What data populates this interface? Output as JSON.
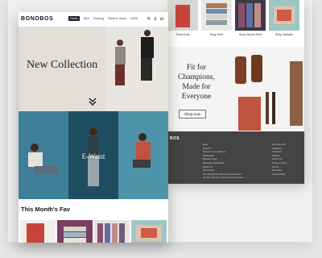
{
  "front": {
    "brand": "BONOBOS",
    "nav_items": [
      "Home",
      "New",
      "Clothing",
      "Pants & Jeans",
      "Shirts"
    ],
    "hero_title": "New Collection",
    "feature_label": "E-Waist",
    "favorites_title": "This Month's Fav"
  },
  "back": {
    "shop_labels": [
      "Shop Knits",
      "Shop Shirt",
      "Shop Woven Shirt",
      "Shop Sweater"
    ],
    "fit_title": "Fit for Champions, Made for Everyone",
    "shop_button": "Shop now",
    "footer_brand": "BOS",
    "footer_col1": [
      "Help",
      "Returns",
      "Showroom Locations",
      "Wholesale",
      "Bonobos App",
      "Discover Guideshop",
      "Email Us",
      "Gift Cards",
      "Do Not Sell My Personal Information",
      "Do Not Sell Your Personal Information"
    ],
    "footer_col2": [
      "Get 15% Off",
      "Students",
      "Teachers",
      "Military",
      "About Us",
      "Privacy Policy",
      "Terms",
      "Site Map",
      "Accessibility"
    ]
  },
  "colors": {
    "hero_bg": "#e2ded8",
    "panel_teal": "#3f7f97",
    "footer_bg": "#444444"
  }
}
